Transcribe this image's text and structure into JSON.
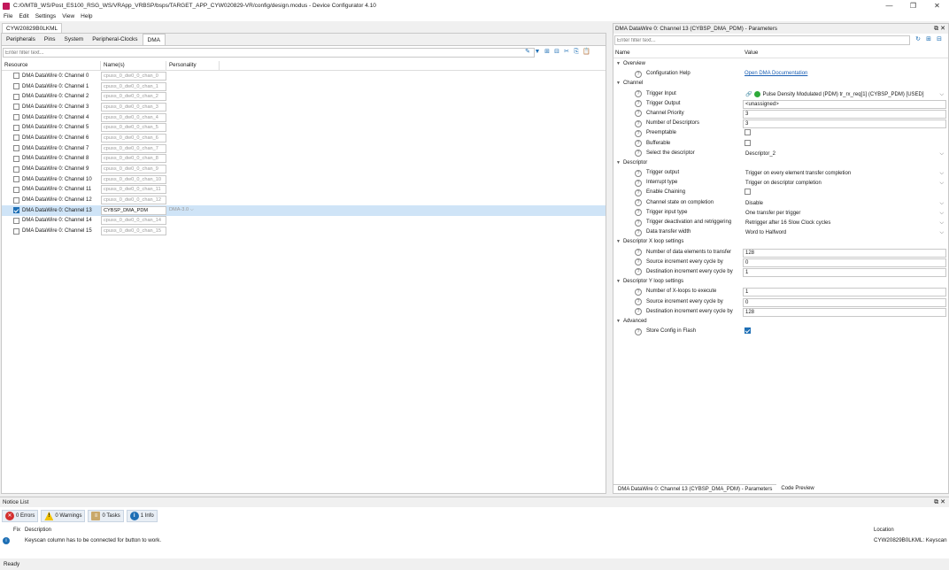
{
  "window": {
    "title": "C:/0/MTB_WS/Post_ES100_RSG_WS/VRApp_VRBSP/bsps/TARGET_APP_CYW020829-VR/config/design.modus - Device Configurator 4.10",
    "minimize": "—",
    "maximize": "❐",
    "close": "✕"
  },
  "menu": [
    "File",
    "Edit",
    "Settings",
    "View",
    "Help"
  ],
  "device_tab": "CYW20829B0LKML",
  "left": {
    "tabs": [
      "Peripherals",
      "Pins",
      "System",
      "Peripheral-Clocks",
      "DMA"
    ],
    "active_tab": "DMA",
    "filter_placeholder": "Enter filter text...",
    "columns": [
      "Resource",
      "Name(s)",
      "Personality"
    ],
    "rows": [
      {
        "resource": "DMA DataWire 0: Channel 0",
        "name": "cpuss_0_dw0_0_chan_0",
        "personality": "",
        "checked": false
      },
      {
        "resource": "DMA DataWire 0: Channel 1",
        "name": "cpuss_0_dw0_0_chan_1",
        "personality": "",
        "checked": false
      },
      {
        "resource": "DMA DataWire 0: Channel 2",
        "name": "cpuss_0_dw0_0_chan_2",
        "personality": "",
        "checked": false
      },
      {
        "resource": "DMA DataWire 0: Channel 3",
        "name": "cpuss_0_dw0_0_chan_3",
        "personality": "",
        "checked": false
      },
      {
        "resource": "DMA DataWire 0: Channel 4",
        "name": "cpuss_0_dw0_0_chan_4",
        "personality": "",
        "checked": false
      },
      {
        "resource": "DMA DataWire 0: Channel 5",
        "name": "cpuss_0_dw0_0_chan_5",
        "personality": "",
        "checked": false
      },
      {
        "resource": "DMA DataWire 0: Channel 6",
        "name": "cpuss_0_dw0_0_chan_6",
        "personality": "",
        "checked": false
      },
      {
        "resource": "DMA DataWire 0: Channel 7",
        "name": "cpuss_0_dw0_0_chan_7",
        "personality": "",
        "checked": false
      },
      {
        "resource": "DMA DataWire 0: Channel 8",
        "name": "cpuss_0_dw0_0_chan_8",
        "personality": "",
        "checked": false
      },
      {
        "resource": "DMA DataWire 0: Channel 9",
        "name": "cpuss_0_dw0_0_chan_9",
        "personality": "",
        "checked": false
      },
      {
        "resource": "DMA DataWire 0: Channel 10",
        "name": "cpuss_0_dw0_0_chan_10",
        "personality": "",
        "checked": false
      },
      {
        "resource": "DMA DataWire 0: Channel 11",
        "name": "cpuss_0_dw0_0_chan_11",
        "personality": "",
        "checked": false
      },
      {
        "resource": "DMA DataWire 0: Channel 12",
        "name": "cpuss_0_dw0_0_chan_12",
        "personality": "",
        "checked": false
      },
      {
        "resource": "DMA DataWire 0: Channel 13",
        "name": "CYBSP_DMA_PDM",
        "personality": "DMA-3.0",
        "checked": true
      },
      {
        "resource": "DMA DataWire 0: Channel 14",
        "name": "cpuss_0_dw0_0_chan_14",
        "personality": "",
        "checked": false
      },
      {
        "resource": "DMA DataWire 0: Channel 15",
        "name": "cpuss_0_dw0_0_chan_15",
        "personality": "",
        "checked": false
      }
    ]
  },
  "right": {
    "title": "DMA DataWire 0: Channel 13 (CYBSP_DMA_PDM) - Parameters",
    "filter_placeholder": "Enter filter text...",
    "col_name": "Name",
    "col_value": "Value",
    "params": [
      {
        "kind": "group",
        "label": "Overview"
      },
      {
        "kind": "param",
        "label": "Configuration Help",
        "value": "Open DMA Documentation",
        "style": "link"
      },
      {
        "kind": "group",
        "label": "Channel"
      },
      {
        "kind": "param",
        "label": "Trigger Input",
        "value": "Pulse Density Modulated (PDM) tr_rx_req[1] (CYBSP_PDM) [USED]",
        "style": "trigger"
      },
      {
        "kind": "param",
        "label": "Trigger Output",
        "value": "<unassigned>",
        "style": "box"
      },
      {
        "kind": "param",
        "label": "Channel Priority",
        "value": "3",
        "style": "box"
      },
      {
        "kind": "param",
        "label": "Number of Descriptors",
        "value": "3",
        "style": "box"
      },
      {
        "kind": "param",
        "label": "Preemptable",
        "value": "",
        "style": "check"
      },
      {
        "kind": "param",
        "label": "Bufferable",
        "value": "",
        "style": "check"
      },
      {
        "kind": "param",
        "label": "Select the descriptor",
        "value": "Descriptor_2",
        "style": "dd"
      },
      {
        "kind": "group",
        "label": "Descriptor"
      },
      {
        "kind": "param",
        "label": "Trigger output",
        "value": "Trigger on every element transfer completion",
        "style": "dd"
      },
      {
        "kind": "param",
        "label": "Interrupt type",
        "value": "Trigger on descriptor completion",
        "style": "dd"
      },
      {
        "kind": "param",
        "label": "Enable Chaining",
        "value": "",
        "style": "check"
      },
      {
        "kind": "param",
        "label": "Channel state on completion",
        "value": "Disable",
        "style": "dd"
      },
      {
        "kind": "param",
        "label": "Trigger input type",
        "value": "One transfer per trigger",
        "style": "dd"
      },
      {
        "kind": "param",
        "label": "Trigger deactivation and retriggering",
        "value": "Retrigger after 16 Slow Clock cycles",
        "style": "dd"
      },
      {
        "kind": "param",
        "label": "Data transfer width",
        "value": "Word to Halfword",
        "style": "dd"
      },
      {
        "kind": "group",
        "label": "Descriptor X loop settings"
      },
      {
        "kind": "param",
        "label": "Number of data elements to transfer",
        "value": "128",
        "style": "box"
      },
      {
        "kind": "param",
        "label": "Source increment every cycle by",
        "value": "0",
        "style": "box"
      },
      {
        "kind": "param",
        "label": "Destination increment every cycle by",
        "value": "1",
        "style": "box"
      },
      {
        "kind": "group",
        "label": "Descriptor Y loop settings"
      },
      {
        "kind": "param",
        "label": "Number of X-loops to execute",
        "value": "1",
        "style": "box"
      },
      {
        "kind": "param",
        "label": "Source increment every cycle by",
        "value": "0",
        "style": "box"
      },
      {
        "kind": "param",
        "label": "Destination increment every cycle by",
        "value": "128",
        "style": "box"
      },
      {
        "kind": "group",
        "label": "Advanced"
      },
      {
        "kind": "param",
        "label": "Store Config in Flash",
        "value": "",
        "style": "checkon"
      }
    ],
    "bottom_tabs": [
      "DMA DataWire 0: Channel 13 (CYBSP_DMA_PDM) - Parameters",
      "Code Preview"
    ]
  },
  "notice": {
    "title": "Notice List",
    "errors": "0 Errors",
    "warnings": "0 Warnings",
    "tasks": "0 Tasks",
    "info": "1 Info",
    "col_fix": "Fix",
    "col_description": "Description",
    "col_location": "Location",
    "message": "Keyscan column has to be connected for button to work.",
    "location": "CYW20829B0LKML: Keyscan"
  },
  "status": "Ready",
  "colors": {
    "accent": "#1e6fb5",
    "selection": "#cfe4f7",
    "error": "#d32f2f",
    "warning": "#f2c200"
  }
}
